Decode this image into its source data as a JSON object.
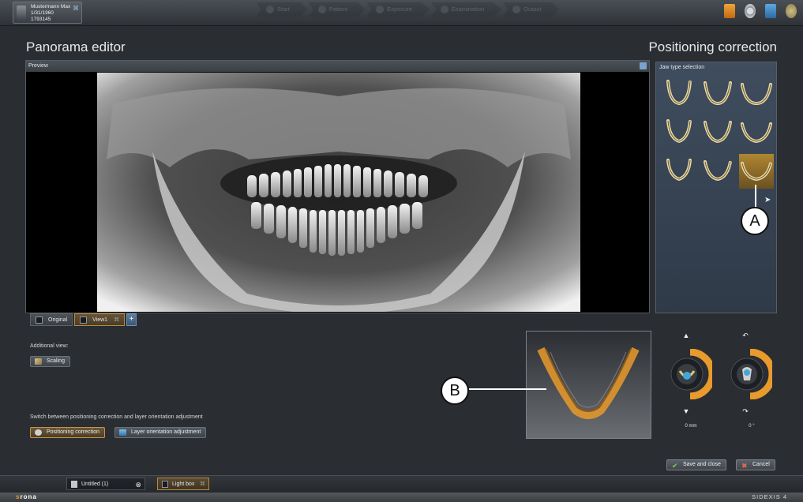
{
  "patient": {
    "name": "Mustermann Max",
    "dob": "1/31/1960",
    "id": "1793145"
  },
  "workflow": {
    "steps": [
      "Start",
      "Patient",
      "Exposure",
      "Examination",
      "Output"
    ]
  },
  "page": {
    "title": "Panorama editor",
    "mode_title": "Positioning correction"
  },
  "preview": {
    "header": "Preview"
  },
  "views": {
    "original": "Original",
    "view1": "View1"
  },
  "additional": {
    "label": "Additional view:",
    "scaling": "Scaling"
  },
  "switch": {
    "label": "Switch between positioning correction and layer orientation adjustment",
    "positioning": "Positioning correction",
    "layer": "Layer orientation adjustment"
  },
  "jaw_panel": {
    "header": "Jaw type selection",
    "selected_index": 8
  },
  "callouts": {
    "a": "A",
    "b": "B"
  },
  "dials": {
    "shift_value": "0",
    "shift_unit": "mm",
    "rotation_value": "0",
    "rotation_unit": "°"
  },
  "actions": {
    "save": "Save and close",
    "cancel": "Cancel"
  },
  "taskbar": {
    "doc": "Untitled (1)",
    "lightbox": "Light box"
  },
  "footer": {
    "brand_prefix": "s",
    "brand_rest": "rona",
    "version": "SIDEXIS 4"
  },
  "colors": {
    "accent": "#e89a2c",
    "panel": "#3a4654",
    "background": "#2a2d31"
  }
}
